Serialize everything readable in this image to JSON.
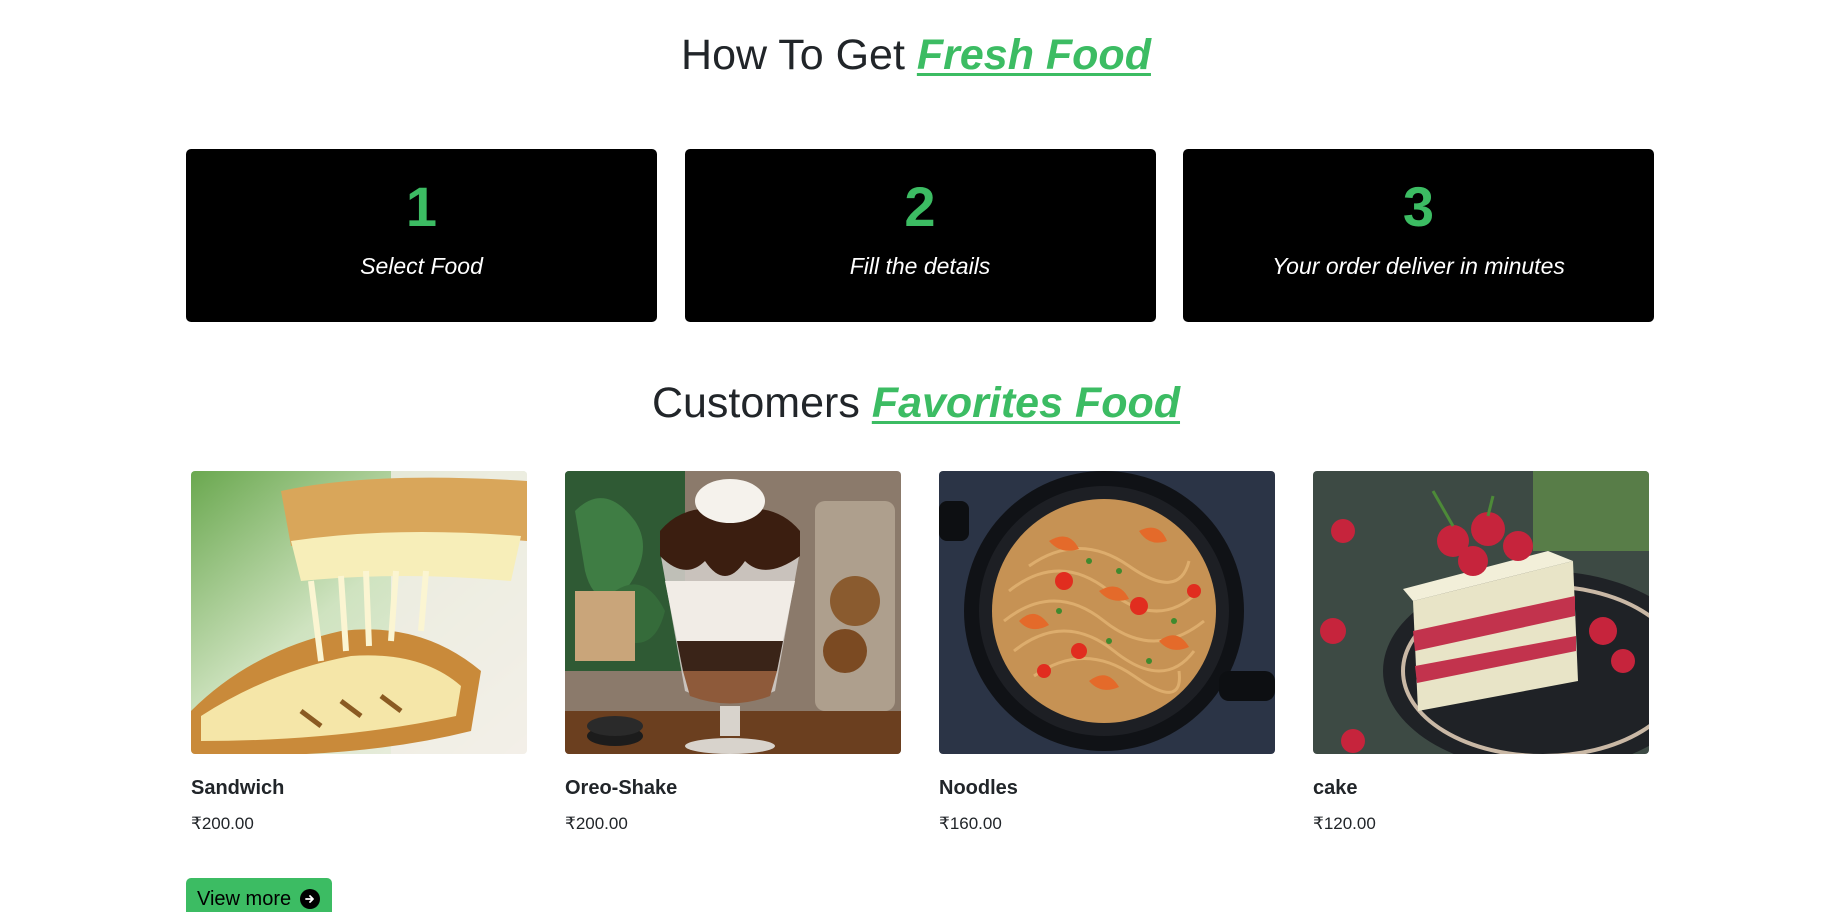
{
  "how_section": {
    "title_prefix": "How To Get",
    "title_accent": "Fresh Food",
    "steps": [
      {
        "number": "1",
        "label": "Select Food"
      },
      {
        "number": "2",
        "label": "Fill the details"
      },
      {
        "number": "3",
        "label": "Your order deliver in minutes"
      }
    ]
  },
  "favorites_section": {
    "title_prefix": "Customers",
    "title_accent": "Favorites Food",
    "products": [
      {
        "name": "Sandwich",
        "price": "₹200.00"
      },
      {
        "name": "Oreo-Shake",
        "price": "₹200.00"
      },
      {
        "name": "Noodles",
        "price": "₹160.00"
      },
      {
        "name": "cake",
        "price": "₹120.00"
      }
    ]
  },
  "view_more": {
    "label": "View more",
    "icon": "arrow-right-circle-icon"
  },
  "colors": {
    "accent": "#3cbc63",
    "card_bg": "#000000",
    "text": "#212529"
  }
}
